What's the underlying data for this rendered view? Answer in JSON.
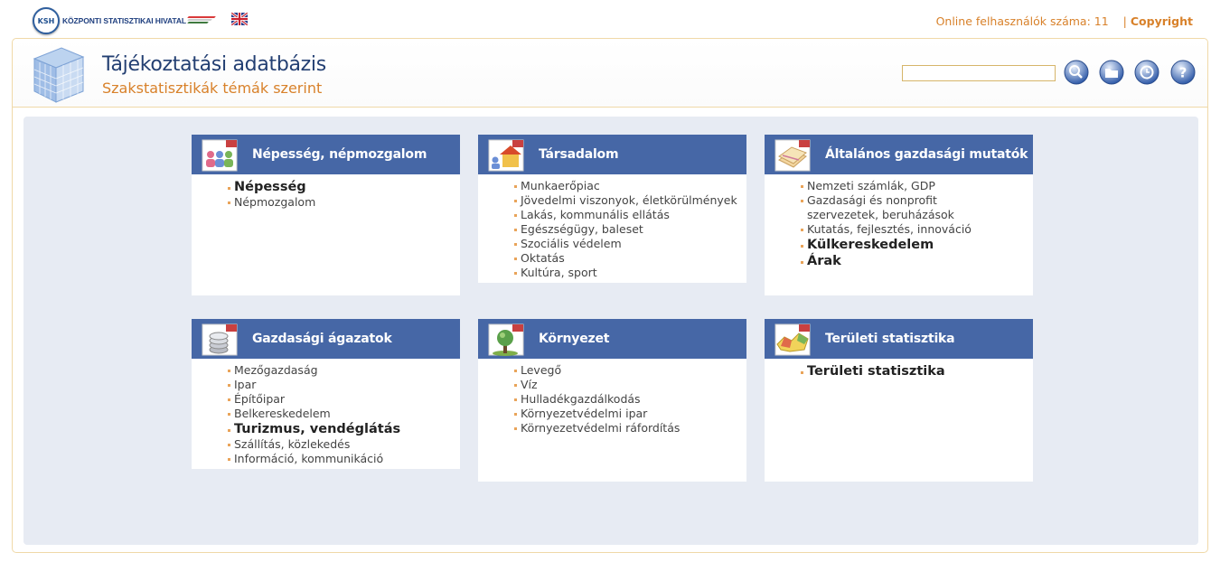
{
  "brand": {
    "badge": "KSH",
    "name": "KÖZPONTI STATISZTIKAI HIVATAL"
  },
  "top": {
    "online_label": "Online felhasználók száma: 11",
    "separator": "|",
    "copyright": "Copyright"
  },
  "header": {
    "title": "Tájékoztatási adatbázis",
    "subtitle": "Szakstatisztikák témák szerint",
    "search": {
      "value": "",
      "placeholder": ""
    }
  },
  "tools": [
    "search-icon",
    "folder-icon",
    "clock-icon",
    "help-icon"
  ],
  "colors": {
    "accent": "#d8812a",
    "panel_header": "#4667a6",
    "content_bg": "#e7ebf3",
    "title": "#233f72"
  },
  "panels": [
    {
      "title": "Népesség, népmozgalom",
      "icon": "people-icon",
      "items": [
        {
          "label": "Népesség",
          "big": true
        },
        {
          "label": "Népmozgalom",
          "big": false
        }
      ]
    },
    {
      "title": "Társadalom",
      "icon": "house-icon",
      "items": [
        {
          "label": "Munkaerőpiac",
          "big": false
        },
        {
          "label": "Jövedelmi viszonyok, életkörülmények",
          "big": false
        },
        {
          "label": "Lakás, kommunális ellátás",
          "big": false
        },
        {
          "label": "Egészségügy, baleset",
          "big": false
        },
        {
          "label": "Szociális védelem",
          "big": false
        },
        {
          "label": "Oktatás",
          "big": false
        },
        {
          "label": "Kultúra, sport",
          "big": false
        }
      ]
    },
    {
      "title": "Általános gazdasági mutatók",
      "icon": "money-icon",
      "items": [
        {
          "label": "Nemzeti számlák, GDP",
          "big": false
        },
        {
          "label": "Gazdasági és nonprofit szervezetek, beruházások",
          "big": false
        },
        {
          "label": "Kutatás, fejlesztés, innováció",
          "big": false
        },
        {
          "label": "Külkereskedelem",
          "big": true
        },
        {
          "label": "Árak",
          "big": true
        }
      ]
    },
    {
      "title": "Gazdasági ágazatok",
      "icon": "coins-icon",
      "items": [
        {
          "label": "Mezőgazdaság",
          "big": false
        },
        {
          "label": "Ipar",
          "big": false
        },
        {
          "label": "Építőipar",
          "big": false
        },
        {
          "label": "Belkereskedelem",
          "big": false
        },
        {
          "label": "Turizmus, vendéglátás",
          "big": true
        },
        {
          "label": "Szállítás, közlekedés",
          "big": false
        },
        {
          "label": "Információ, kommunikáció",
          "big": false
        }
      ]
    },
    {
      "title": "Környezet",
      "icon": "tree-icon",
      "items": [
        {
          "label": "Levegő",
          "big": false
        },
        {
          "label": "Víz",
          "big": false
        },
        {
          "label": "Hulladékgazdálkodás",
          "big": false
        },
        {
          "label": "Környezetvédelmi ipar",
          "big": false
        },
        {
          "label": "Környezetvédelmi ráfordítás",
          "big": false
        }
      ]
    },
    {
      "title": "Területi statisztika",
      "icon": "map-icon",
      "items": [
        {
          "label": "Területi statisztika",
          "big": true
        }
      ]
    }
  ]
}
